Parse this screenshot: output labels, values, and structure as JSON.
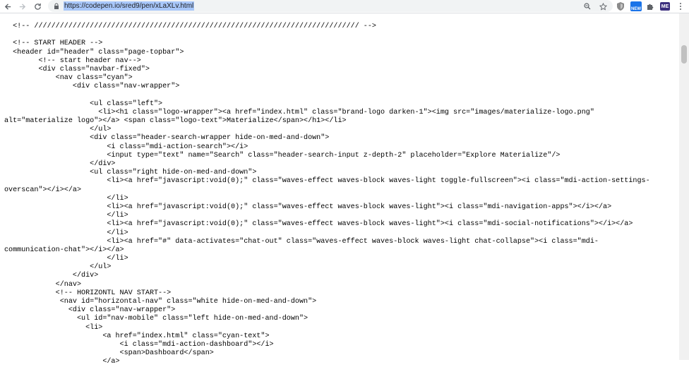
{
  "browser": {
    "url": "https://codepen.io/sred9/pen/xLaXLv.html",
    "icons": {
      "back": "arrow-left-icon",
      "forward": "arrow-right-icon",
      "reload": "reload-icon",
      "lock": "lock-icon",
      "zoom": "zoom-icon",
      "star": "star-icon",
      "extensions": "puzzle-icon",
      "menu": "kebab-menu-icon"
    },
    "extension_badge": "NEW",
    "profile_badge": "ME",
    "accent_color": "#a8c7fa"
  },
  "source_lines": [
    "  <!-- //////////////////////////////////////////////////////////////////////////// -->",
    "",
    "  <!-- START HEADER -->",
    "  <header id=\"header\" class=\"page-topbar\">",
    "        <!-- start header nav-->",
    "        <div class=\"navbar-fixed\">",
    "            <nav class=\"cyan\">",
    "                <div class=\"nav-wrapper\">",
    "",
    "                    <ul class=\"left\">",
    "                      <li><h1 class=\"logo-wrapper\"><a href=\"index.html\" class=\"brand-logo darken-1\"><img src=\"images/materialize-logo.png\"",
    "alt=\"materialize logo\"></a> <span class=\"logo-text\">Materialize</span></h1></li>",
    "                    </ul>",
    "                    <div class=\"header-search-wrapper hide-on-med-and-down\">",
    "                        <i class=\"mdi-action-search\"></i>",
    "                        <input type=\"text\" name=\"Search\" class=\"header-search-input z-depth-2\" placeholder=\"Explore Materialize\"/>",
    "                    </div>",
    "                    <ul class=\"right hide-on-med-and-down\">",
    "                        <li><a href=\"javascript:void(0);\" class=\"waves-effect waves-block waves-light toggle-fullscreen\"><i class=\"mdi-action-settings-",
    "overscan\"></i></a>",
    "                        </li>",
    "                        <li><a href=\"javascript:void(0);\" class=\"waves-effect waves-block waves-light\"><i class=\"mdi-navigation-apps\"></i></a>",
    "                        </li>",
    "                        <li><a href=\"javascript:void(0);\" class=\"waves-effect waves-block waves-light\"><i class=\"mdi-social-notifications\"></i></a>",
    "                        </li>",
    "                        <li><a href=\"#\" data-activates=\"chat-out\" class=\"waves-effect waves-block waves-light chat-collapse\"><i class=\"mdi-",
    "communication-chat\"></i></a>",
    "                        </li>",
    "                    </ul>",
    "                </div>",
    "            </nav>",
    "            <!-- HORIZONTL NAV START-->",
    "             <nav id=\"horizontal-nav\" class=\"white hide-on-med-and-down\">",
    "               <div class=\"nav-wrapper\">",
    "                 <ul id=\"nav-mobile\" class=\"left hide-on-med-and-down\">",
    "                   <li>",
    "                       <a href=\"index.html\" class=\"cyan-text\">",
    "                           <i class=\"mdi-action-dashboard\"></i>",
    "                           <span>Dashboard</span>",
    "                       </a>"
  ]
}
